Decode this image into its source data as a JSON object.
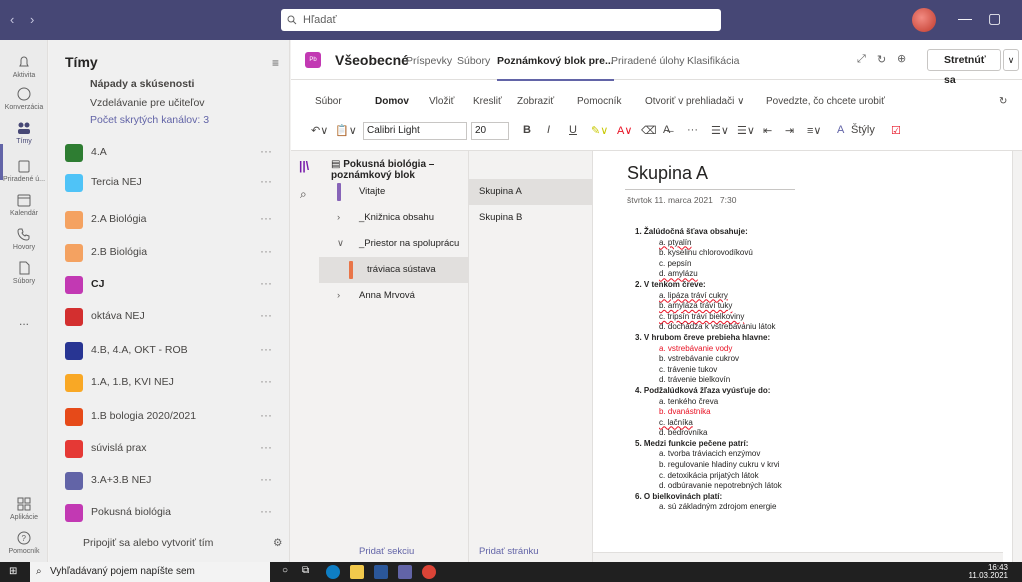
{
  "titlebar": {
    "nav_arrows": "‹  ›",
    "search_placeholder": "Hľadať",
    "window_controls": [
      "—",
      "▢"
    ]
  },
  "rail": [
    {
      "label": "Aktivita",
      "icon": "bell-icon"
    },
    {
      "label": "Konverzácia",
      "icon": "chat-icon"
    },
    {
      "label": "Tímy",
      "icon": "teams-icon",
      "active": true
    },
    {
      "label": "Priradené ú...",
      "icon": "assignments-icon"
    },
    {
      "label": "Kalendár",
      "icon": "calendar-icon"
    },
    {
      "label": "Hovory",
      "icon": "phone-icon"
    },
    {
      "label": "Súbory",
      "icon": "file-icon"
    },
    {
      "label": "...",
      "icon": "more-icon"
    },
    {
      "label": "Aplikácie",
      "icon": "apps-icon"
    },
    {
      "label": "Pomocník",
      "icon": "help-icon"
    }
  ],
  "teams": {
    "header": "Tímy",
    "sub_channels": [
      "Nápady a skúsenosti",
      "Vzdelávanie pre učiteľov",
      "Počet skrytých kanálov: 3"
    ],
    "items": [
      {
        "name": "4.A",
        "color": "#2e7d32",
        "bold": false
      },
      {
        "name": "Tercia NEJ",
        "color": "#4fc3f7",
        "bold": false
      },
      {
        "name": "2.A Biológia",
        "color": "#f4a261",
        "bold": false
      },
      {
        "name": "2.B Biológia",
        "color": "#f4a261",
        "bold": false
      },
      {
        "name": "CJ",
        "color": "#c239b3",
        "bold": true
      },
      {
        "name": "oktáva NEJ",
        "color": "#d32f2f",
        "bold": false
      },
      {
        "name": "4.B, 4.A, OKT - ROB",
        "color": "#283593",
        "bold": false
      },
      {
        "name": "1.A, 1.B, KVI NEJ",
        "color": "#f9a825",
        "bold": false
      },
      {
        "name": "1.B bologia 2020/2021",
        "color": "#e64a19",
        "bold": false
      },
      {
        "name": "súvislá prax",
        "color": "#e53935",
        "bold": false
      },
      {
        "name": "3.A+3.B NEJ",
        "color": "#6264a7",
        "bold": false
      },
      {
        "name": "Pokusná biológia",
        "color": "#c239b3",
        "bold": false
      }
    ],
    "more": "···",
    "join_label": "Pripojiť sa alebo vytvoriť tím"
  },
  "channel": {
    "logo_text": "Pb",
    "title": "Všeobecné",
    "tabs": [
      "Príspevky",
      "Súbory",
      "Poznámkový blok pre...",
      "Priradené úlohy",
      "Klasifikácia"
    ],
    "active_tab": 2,
    "meet_label": "Stretnúť sa"
  },
  "ribbon": {
    "tabs": [
      "Súbor",
      "Domov",
      "Vložiť",
      "Kresliť",
      "Zobraziť",
      "Pomocník",
      "Otvoriť v prehliadači ∨",
      "Povedzte, čo chcete urobiť"
    ],
    "active": 1,
    "font_name": "Calibri Light",
    "font_size": "20",
    "styles_label": "Štýly"
  },
  "notebook": {
    "title": "Pokusná biológia – poznámkový blok",
    "sections": [
      {
        "label": "Vitajte",
        "kind": "tag-purple"
      },
      {
        "label": "_Knižnica obsahu",
        "kind": "chev-right"
      },
      {
        "label": "_Priestor na spoluprácu",
        "kind": "chev-down"
      },
      {
        "label": "tráviaca sústava",
        "kind": "tag-orange",
        "selected": true
      },
      {
        "label": "Anna Mrvová",
        "kind": "chev-right"
      }
    ],
    "pages": [
      {
        "label": "Skupina A",
        "selected": true
      },
      {
        "label": "Skupina B",
        "selected": false
      }
    ],
    "add_section": "Pridať sekciu",
    "add_page": "Pridať stránku"
  },
  "page": {
    "title": "Skupina A",
    "date": "štvrtok 11. marca 2021",
    "time": "7:30",
    "questions": [
      {
        "q": "1.   Žalúdočná šťava obsahuje:",
        "answers": [
          {
            "t": "a.  ptyalín",
            "red": false,
            "ul": true
          },
          {
            "t": "b.  kyselinu chlorovodíkovú",
            "red": false
          },
          {
            "t": "c.  pepsín",
            "red": false
          },
          {
            "t": "d.  amylázu",
            "red": false,
            "ul": true
          }
        ]
      },
      {
        "q": "2.   V tenkom čreve:",
        "answers": [
          {
            "t": "a.  lipáza tráví cukry",
            "red": false,
            "ul": true
          },
          {
            "t": "b.  amyláza tráví tuky",
            "red": false,
            "ul": true
          },
          {
            "t": "c.  tripsín tráví bielkoviny",
            "red": false,
            "ul": true
          },
          {
            "t": "d.  dochádza k vstrebávaniu látok",
            "red": false
          }
        ]
      },
      {
        "q": "3.   V hrubom čreve prebieha hlavne:",
        "answers": [
          {
            "t": "a.  vstrebávanie vody",
            "red": true
          },
          {
            "t": "b.  vstrebávanie cukrov",
            "red": false
          },
          {
            "t": "c.  trávenie tukov",
            "red": false
          },
          {
            "t": "d.  trávenie bielkovín",
            "red": false
          }
        ]
      },
      {
        "q": "4.   Podžalúdková žľaza vyúsťuje do:",
        "answers": [
          {
            "t": "a.  tenkého čreva",
            "red": false
          },
          {
            "t": "b.  dvanástnika",
            "red": true
          },
          {
            "t": "c.  lačníka",
            "red": false,
            "ul": true
          },
          {
            "t": "d.  bedrovníka",
            "red": false
          }
        ]
      },
      {
        "q": "5.   Medzi funkcie pečene patrí:",
        "answers": [
          {
            "t": "a.  tvorba tráviacich enzýmov",
            "red": false
          },
          {
            "t": "b.  regulovanie hladiny cukru v krvi",
            "red": false
          },
          {
            "t": "c.  detoxikácia prijatých látok",
            "red": false
          },
          {
            "t": "d.  odbúravanie nepotrebných látok",
            "red": false
          }
        ]
      },
      {
        "q": "6.   O bielkovinách platí:",
        "answers": [
          {
            "t": "a.  sú základným zdrojom energie",
            "red": false
          }
        ]
      }
    ]
  },
  "taskbar": {
    "search_placeholder": "Vyhľadávaný pojem napíšte sem",
    "time": "16:43",
    "date": "11.03.2021"
  }
}
